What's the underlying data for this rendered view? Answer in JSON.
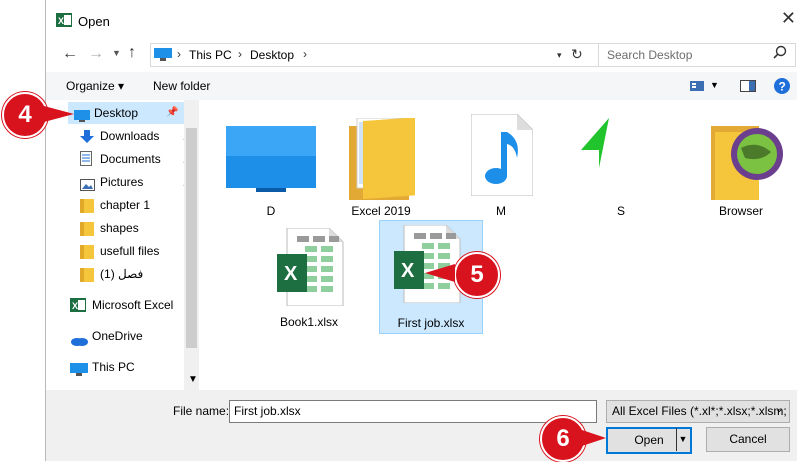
{
  "window": {
    "title": "Open",
    "close_symbol": "✕"
  },
  "nav": {
    "breadcrumb": [
      "This PC",
      "Desktop"
    ],
    "search_placeholder": "Search Desktop"
  },
  "toolbar": {
    "organize_label": "Organize",
    "new_folder_label": "New folder"
  },
  "sidebar": {
    "items": [
      {
        "label": "Desktop",
        "icon": "desktop-icon"
      },
      {
        "label": "Downloads",
        "icon": "download-icon"
      },
      {
        "label": "Documents",
        "icon": "document-icon"
      },
      {
        "label": "Pictures",
        "icon": "pictures-icon"
      },
      {
        "label": "chapter 1",
        "icon": "folder-icon"
      },
      {
        "label": "shapes",
        "icon": "folder-icon"
      },
      {
        "label": "usefull files",
        "icon": "folder-icon"
      },
      {
        "label": "فصل (1)",
        "icon": "folder-icon"
      },
      {
        "label": "Microsoft Excel",
        "icon": "excel-icon"
      },
      {
        "label": "OneDrive",
        "icon": "onedrive-icon"
      },
      {
        "label": "This PC",
        "icon": "thispc-icon"
      }
    ]
  },
  "files": [
    {
      "label": "D",
      "icon": "monitor-icon"
    },
    {
      "label": "Excel 2019",
      "icon": "folder-icon"
    },
    {
      "label": "M",
      "icon": "music-file-icon"
    },
    {
      "label": "S",
      "icon": "green-arrow-icon"
    },
    {
      "label": "Browser",
      "icon": "browser-folder-icon"
    },
    {
      "label": "Book1.xlsx",
      "icon": "excel-file-icon"
    },
    {
      "label": "First job.xlsx",
      "icon": "excel-file-icon"
    }
  ],
  "bottom": {
    "filename_label": "File name:",
    "filename_value": "First job.xlsx",
    "filetype_value": "All Excel Files (*.xl*;*.xlsx;*.xlsm;",
    "open_label": "Open",
    "cancel_label": "Cancel"
  },
  "callouts": [
    "4",
    "5",
    "6"
  ],
  "colors": {
    "accent": "#0078d7",
    "callout": "#d8131e",
    "selection": "#cce8ff",
    "excel": "#1d6f42"
  }
}
